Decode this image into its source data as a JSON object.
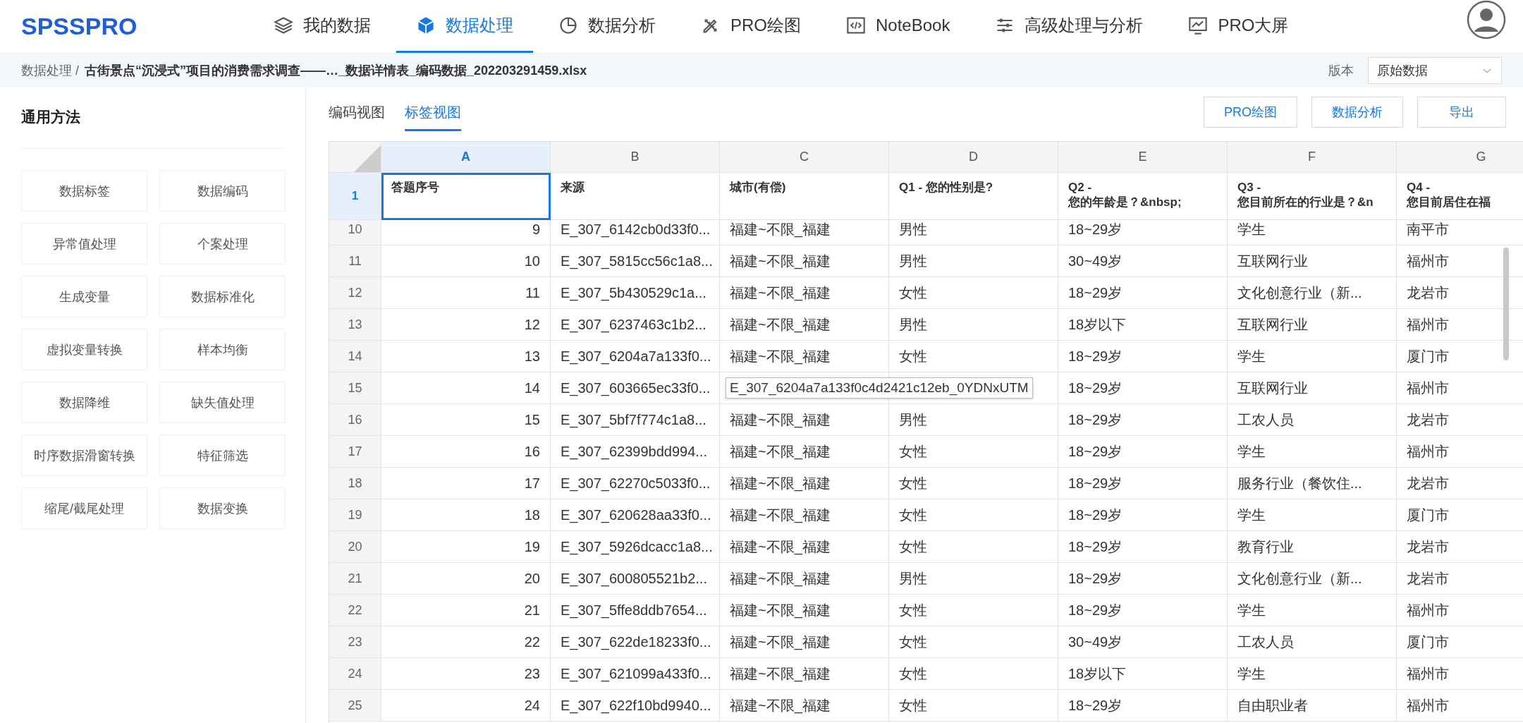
{
  "logo": "SPSSPRO",
  "nav": [
    {
      "label": "我的数据",
      "selected": false
    },
    {
      "label": "数据处理",
      "selected": true
    },
    {
      "label": "数据分析",
      "selected": false
    },
    {
      "label": "PRO绘图",
      "selected": false
    },
    {
      "label": "NoteBook",
      "selected": false
    },
    {
      "label": "高级处理与分析",
      "selected": false
    },
    {
      "label": "PRO大屏",
      "selected": false
    }
  ],
  "breadcrumb": {
    "parent": "数据处理 /",
    "current": "古街景点“沉浸式”项目的消费需求调查——…_数据详情表_编码数据_202203291459.xlsx"
  },
  "version": {
    "label": "版本",
    "value": "原始数据"
  },
  "sidebar": {
    "title": "通用方法",
    "items": [
      "数据标签",
      "数据编码",
      "异常值处理",
      "个案处理",
      "生成变量",
      "数据标准化",
      "虚拟变量转换",
      "样本均衡",
      "数据降维",
      "缺失值处理",
      "时序数据滑窗转换",
      "特征筛选",
      "缩尾/截尾处理",
      "数据变换"
    ]
  },
  "view_tabs": [
    {
      "label": "编码视图",
      "selected": false
    },
    {
      "label": "标签视图",
      "selected": true
    }
  ],
  "actions": [
    "PRO绘图",
    "数据分析",
    "导出"
  ],
  "sheet": {
    "header_row": {
      "number": "1",
      "selected": true
    },
    "columns": [
      {
        "letter": "A",
        "label": "答题序号",
        "selected": true
      },
      {
        "letter": "B",
        "label": "来源",
        "selected": false
      },
      {
        "letter": "C",
        "label": "城市(有偿)",
        "selected": false
      },
      {
        "letter": "D",
        "label": "Q1 - 您的性别是?",
        "selected": false
      },
      {
        "letter": "E",
        "label": "Q2 -\n您的年龄是？&nbsp;",
        "selected": false
      },
      {
        "letter": "F",
        "label": "Q3 -\n您目前所在的行业是？&n",
        "selected": false
      },
      {
        "letter": "G",
        "label": "Q4 -\n您目前居住在福",
        "selected": false
      }
    ],
    "rows": [
      {
        "number": "10",
        "cells": [
          "9",
          "E_307_6142cb0d33f0...",
          "福建~不限_福建",
          "男性",
          "18~29岁",
          "学生",
          "南平市"
        ]
      },
      {
        "number": "11",
        "cells": [
          "10",
          "E_307_5815cc56c1a8...",
          "福建~不限_福建",
          "男性",
          "30~49岁",
          "互联网行业",
          "福州市"
        ]
      },
      {
        "number": "12",
        "cells": [
          "11",
          "E_307_5b430529c1a...",
          "福建~不限_福建",
          "女性",
          "18~29岁",
          "文化创意行业（新...",
          "龙岩市"
        ]
      },
      {
        "number": "13",
        "cells": [
          "12",
          "E_307_6237463c1b2...",
          "福建~不限_福建",
          "男性",
          "18岁以下",
          "互联网行业",
          "福州市"
        ]
      },
      {
        "number": "14",
        "cells": [
          "13",
          "E_307_6204a7a133f0...",
          "福建~不限_福建",
          "女性",
          "18~29岁",
          "学生",
          "厦门市"
        ]
      },
      {
        "number": "15",
        "cells": [
          "14",
          "E_307_603665ec33f0...",
          "",
          "",
          "18~29岁",
          "互联网行业",
          "福州市"
        ],
        "tooltip": "E_307_6204a7a133f0c4d2421c12eb_0YDNxUTM"
      },
      {
        "number": "16",
        "cells": [
          "15",
          "E_307_5bf7f774c1a8...",
          "福建~不限_福建",
          "男性",
          "18~29岁",
          "工农人员",
          "龙岩市"
        ]
      },
      {
        "number": "17",
        "cells": [
          "16",
          "E_307_62399bdd994...",
          "福建~不限_福建",
          "女性",
          "18~29岁",
          "学生",
          "福州市"
        ]
      },
      {
        "number": "18",
        "cells": [
          "17",
          "E_307_62270c5033f0...",
          "福建~不限_福建",
          "女性",
          "18~29岁",
          "服务行业（餐饮住...",
          "龙岩市"
        ]
      },
      {
        "number": "19",
        "cells": [
          "18",
          "E_307_620628aa33f0...",
          "福建~不限_福建",
          "女性",
          "18~29岁",
          "学生",
          "厦门市"
        ]
      },
      {
        "number": "20",
        "cells": [
          "19",
          "E_307_5926dcacc1a8...",
          "福建~不限_福建",
          "女性",
          "18~29岁",
          "教育行业",
          "龙岩市"
        ]
      },
      {
        "number": "21",
        "cells": [
          "20",
          "E_307_600805521b2...",
          "福建~不限_福建",
          "男性",
          "18~29岁",
          "文化创意行业（新...",
          "龙岩市"
        ]
      },
      {
        "number": "22",
        "cells": [
          "21",
          "E_307_5ffe8ddb7654...",
          "福建~不限_福建",
          "女性",
          "18~29岁",
          "学生",
          "福州市"
        ]
      },
      {
        "number": "23",
        "cells": [
          "22",
          "E_307_622de18233f0...",
          "福建~不限_福建",
          "女性",
          "30~49岁",
          "工农人员",
          "厦门市"
        ]
      },
      {
        "number": "24",
        "cells": [
          "23",
          "E_307_621099a433f0...",
          "福建~不限_福建",
          "女性",
          "18岁以下",
          "学生",
          "福州市"
        ]
      },
      {
        "number": "25",
        "cells": [
          "24",
          "E_307_622f10bd9940...",
          "福建~不限_福建",
          "女性",
          "18~29岁",
          "自由职业者",
          "福州市"
        ]
      }
    ]
  }
}
